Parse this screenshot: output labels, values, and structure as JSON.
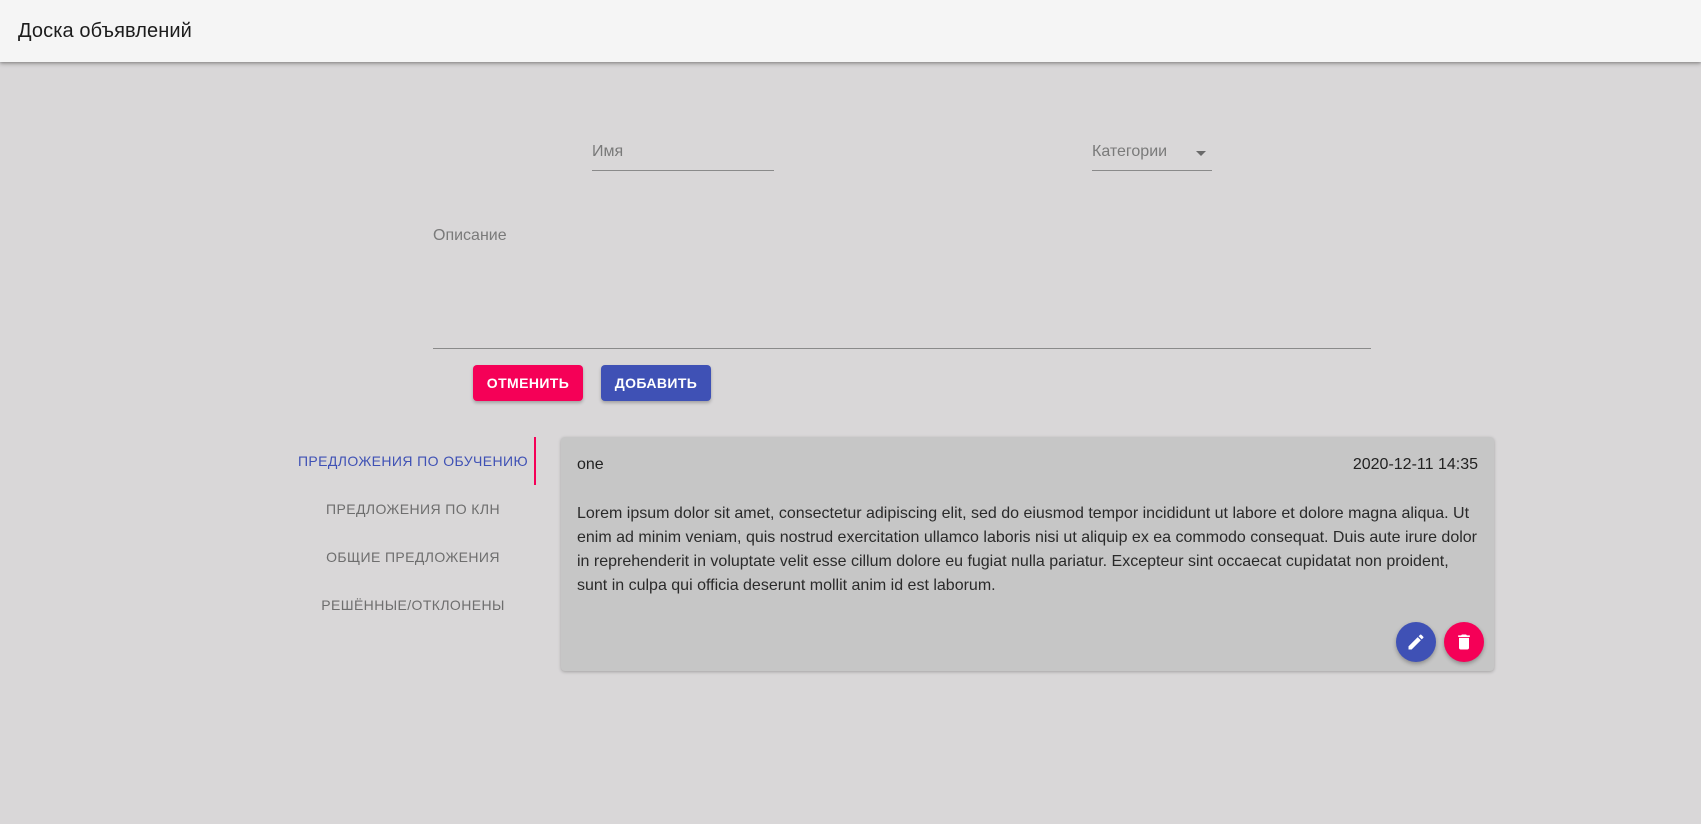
{
  "appbar": {
    "title": "Доска объявлений"
  },
  "form": {
    "name_label": "Имя",
    "category_label": "Категории",
    "description_label": "Описание",
    "cancel_label": "ОТМЕНИТЬ",
    "add_label": "ДОБАВИТЬ"
  },
  "tabs": [
    {
      "label": "ПРЕДЛОЖЕНИЯ ПО ОБУЧЕНИЮ",
      "active": true
    },
    {
      "label": "ПРЕДЛОЖЕНИЯ ПО КЛН",
      "active": false
    },
    {
      "label": "ОБЩИЕ ПРЕДЛОЖЕНИЯ",
      "active": false
    },
    {
      "label": "РЕШЁННЫЕ/ОТКЛОНЕНЫ",
      "active": false
    }
  ],
  "card": {
    "title": "one",
    "date": "2020-12-11 14:35",
    "body": "Lorem ipsum dolor sit amet, consectetur adipiscing elit, sed do eiusmod tempor incididunt ut labore et dolore magna aliqua. Ut enim ad minim veniam, quis nostrud exercitation ullamco laboris nisi ut aliquip ex ea commodo consequat. Duis aute irure dolor in reprehenderit in voluptate velit esse cillum dolore eu fugiat nulla pariatur. Excepteur sint occaecat cupidatat non proident, sunt in culpa qui officia deserunt mollit anim id est laborum.",
    "edit_icon": "pencil-icon",
    "delete_icon": "trash-icon"
  },
  "colors": {
    "primary": "#3f51b5",
    "secondary": "#f50057",
    "background": "#d9d7d8",
    "card": "#c6c6c6"
  }
}
